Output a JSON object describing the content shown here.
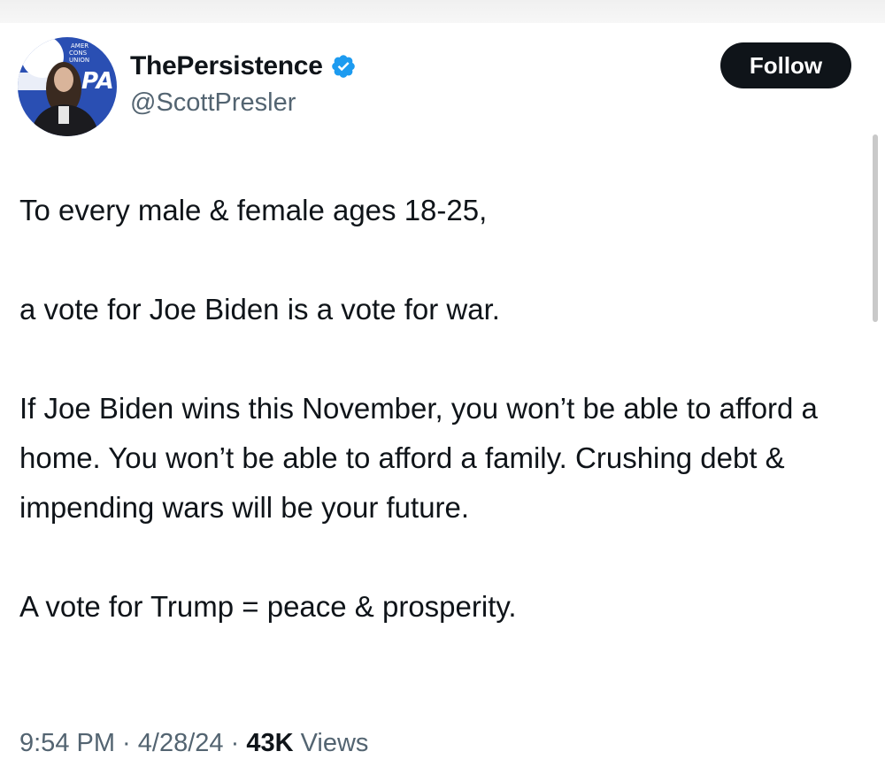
{
  "author": {
    "display_name": "ThePersistence",
    "handle": "@ScottPresler",
    "verified_icon": "verified-badge-icon",
    "avatar_badge_text": "AMERICAN CONSERVATIVE UNION CPA"
  },
  "follow_label": "Follow",
  "tweet": {
    "paragraphs": [
      "To every male & female ages 18-25,",
      "a vote for Joe Biden is a vote for war.",
      "If Joe Biden wins this November, you won’t be able to afford a home. You won’t be able to afford a family. Crushing debt & impending wars will be your future.",
      "A vote for Trump = peace & prosperity."
    ]
  },
  "meta": {
    "time": "9:54 PM",
    "separator": " · ",
    "date": "4/28/24",
    "views_count": "43K",
    "views_label": " Views"
  },
  "colors": {
    "verified_blue": "#1d9bf0",
    "button_black": "#0f1419",
    "secondary_text": "#536471"
  }
}
